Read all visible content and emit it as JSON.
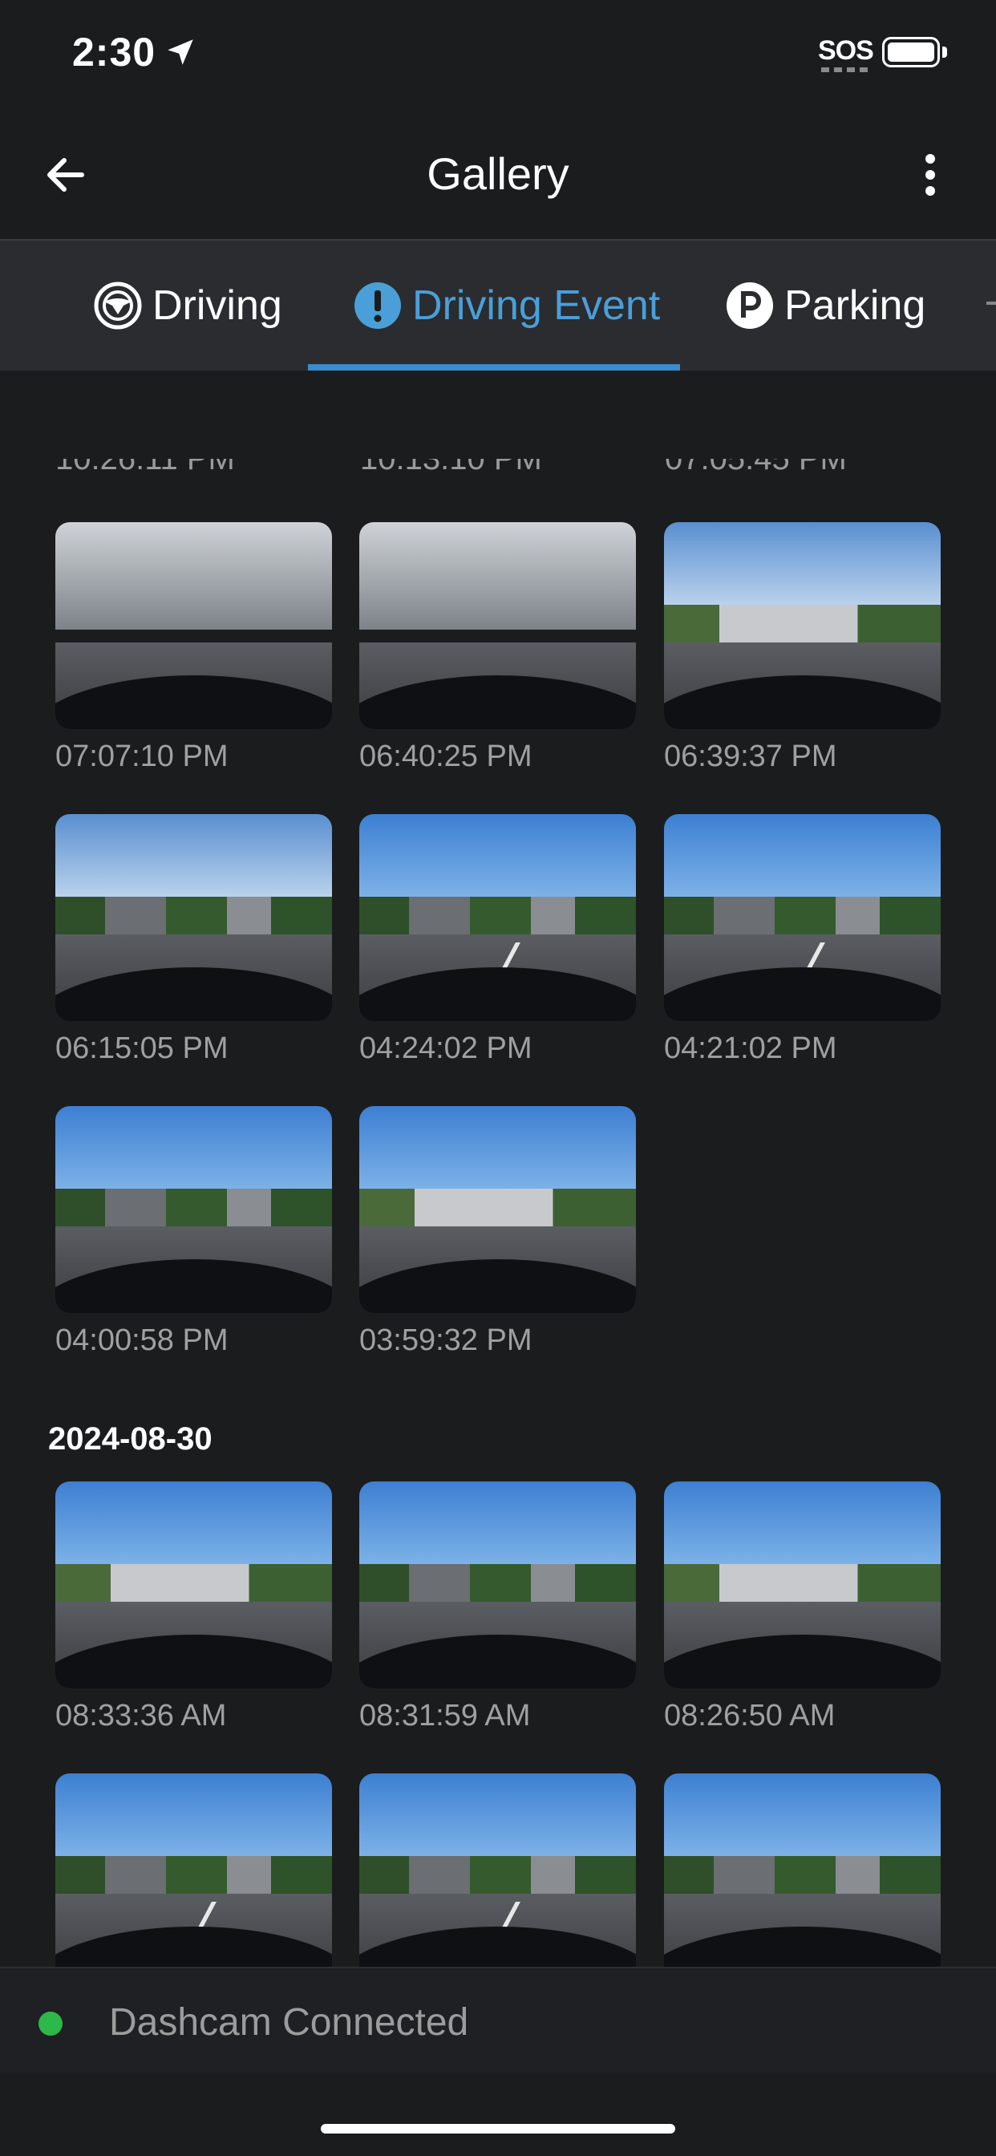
{
  "status_bar": {
    "time": "2:30",
    "sos": "SOS"
  },
  "header": {
    "title": "Gallery"
  },
  "tabs": [
    {
      "label": "Driving",
      "icon": "steering-wheel-icon",
      "active": false
    },
    {
      "label": "Driving Event",
      "icon": "exclamation-icon",
      "active": true
    },
    {
      "label": "Parking",
      "icon": "parking-icon",
      "active": false
    }
  ],
  "colors": {
    "accent": "#4a9fd8",
    "background": "#1b1c1e",
    "connected": "#2db84a"
  },
  "groups": [
    {
      "date": "",
      "items": [
        {
          "time": "07:07:10 PM"
        },
        {
          "time": "06:40:25 PM"
        },
        {
          "time": "06:39:37 PM"
        },
        {
          "time": "06:15:05 PM"
        },
        {
          "time": "04:24:02 PM"
        },
        {
          "time": "04:21:02 PM"
        },
        {
          "time": "04:00:58 PM"
        },
        {
          "time": "03:59:32 PM"
        }
      ]
    },
    {
      "date": "2024-08-30",
      "items": [
        {
          "time": "08:33:36 AM"
        },
        {
          "time": "08:31:59 AM"
        },
        {
          "time": "08:26:50 AM"
        },
        {
          "time": ""
        },
        {
          "time": ""
        },
        {
          "time": ""
        }
      ]
    }
  ],
  "footer": {
    "status": "Dashcam Connected"
  }
}
